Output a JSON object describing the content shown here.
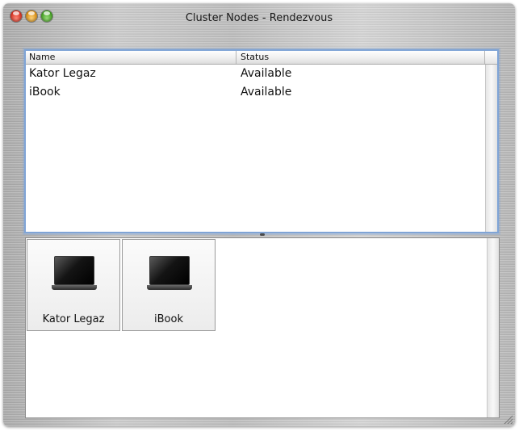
{
  "window": {
    "title": "Cluster Nodes - Rendezvous",
    "buttons": {
      "close": "close-icon",
      "minimize": "minimize-icon",
      "zoom": "zoom-icon"
    }
  },
  "table": {
    "columns": [
      "Name",
      "Status"
    ],
    "rows": [
      {
        "name": "Kator Legaz",
        "status": "Available"
      },
      {
        "name": "iBook",
        "status": "Available"
      }
    ]
  },
  "nodes": {
    "items": [
      {
        "label": "Kator Legaz",
        "icon": "laptop-icon"
      },
      {
        "label": "iBook",
        "icon": "laptop-icon"
      }
    ]
  },
  "colors": {
    "selection_border": "#7fa4d6",
    "close": "#d42a1a",
    "minimize": "#d98a0c",
    "zoom": "#3c9a1c"
  }
}
